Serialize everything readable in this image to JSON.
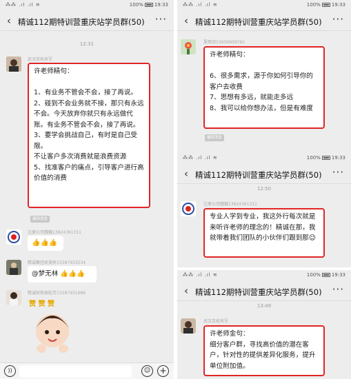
{
  "status": {
    "signals": "⁂⁂ .ıl .ıl ≋",
    "battery": "100%",
    "clock": "19:33"
  },
  "chat_title": "精诚112期特训营重庆站学员群(50)",
  "p1": {
    "time": "12:31",
    "m1": {
      "sender": "武汉百拓肖军",
      "text": "许老师精句：\n\n1、有业务不管会不会，接了再说。\n2、碰到不会业务就不接，那只有永远不会。今天放弃你就只有永远做代账。有业务不管会不会，接了再说。\n3、要学会挑战自己，有时是自己受限。\n不让客户多次消费就是浪费资源\n5、找准客户的痛点，引导客户进行高价值的消费"
    },
    "recall": "撤回消息",
    "m2": {
      "sender": "注册公司魏巍13824361311",
      "text": "👍👍👍"
    },
    "m3": {
      "sender": "精诚集团吴美桥15587933234",
      "text": "@梦无林 👍👍👍"
    },
    "m4": {
      "sender": "精诚财税谢桂芳15587931986",
      "sticker": "赞 赞 赞"
    }
  },
  "p2": {
    "m1": {
      "sender": "夏雨润15656909762",
      "text": "许老师精句：\n\n6、很多需求，源于你如何引导你的客户去收费\n7、思想有多远，就能走多远\n8、我可以给你想办法，但是有难度"
    },
    "recall": "撤回消息"
  },
  "p3": {
    "time": "12:50",
    "m1": {
      "sender": "注册公司魏巍13824361311",
      "text": "专业人学到专业，我这外行每次就是来听许老师的理念的！精诚在那，我就带着我们团队的小伙伴们跟到那😉"
    }
  },
  "p4": {
    "time": "13:49",
    "m1": {
      "sender": "武汉百拓肖军",
      "text": "许老师金句：\n细分客户群，寻找高价值的潜在客户，针对性的提供差异化服务，提升单位附加值。"
    }
  },
  "icons": [
    "back-icon",
    "more-icon",
    "voice-icon",
    "emoji-icon",
    "plus-icon"
  ]
}
